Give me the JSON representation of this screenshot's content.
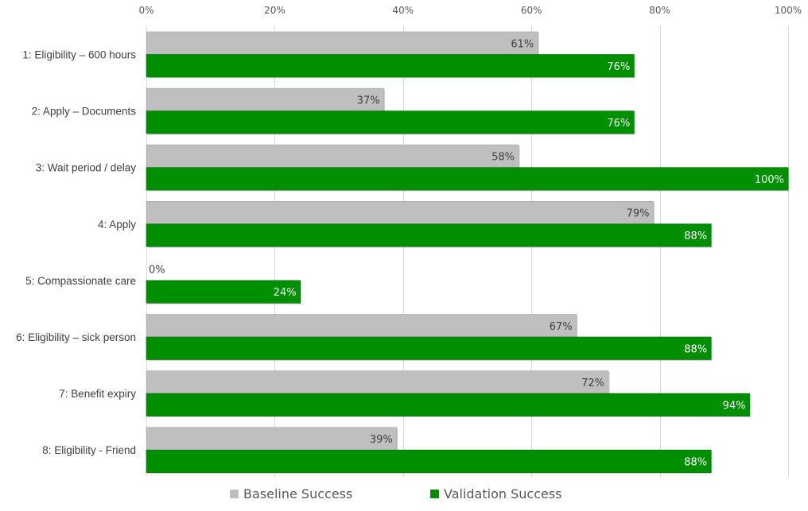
{
  "chart_data": {
    "type": "bar",
    "orientation": "horizontal",
    "title": "",
    "xlabel": "",
    "ylabel": "",
    "xlim": [
      0,
      100
    ],
    "x_ticks": [
      "0%",
      "20%",
      "40%",
      "60%",
      "80%",
      "100%"
    ],
    "x_tick_values": [
      0,
      20,
      40,
      60,
      80,
      100
    ],
    "grid": true,
    "x_axis_position": "top",
    "legend_position": "bottom",
    "categories": [
      "1: Eligibility – 600 hours",
      "2: Apply – Documents",
      "3: Wait period / delay",
      "4: Apply",
      "5: Compassionate care",
      "6: Eligibility – sick person",
      "7: Benefit expiry",
      "8: Eligibility - Friend"
    ],
    "series": [
      {
        "name": "Baseline Success",
        "color": "#BFBFBF",
        "values": [
          61,
          37,
          58,
          79,
          0,
          67,
          72,
          39
        ],
        "labels": [
          "61%",
          "37%",
          "58%",
          "79%",
          "0%",
          "67%",
          "72%",
          "39%"
        ]
      },
      {
        "name": "Validation Success",
        "color": "#008F00",
        "values": [
          76,
          76,
          100,
          88,
          24,
          88,
          94,
          88
        ],
        "labels": [
          "76%",
          "76%",
          "100%",
          "88%",
          "24%",
          "88%",
          "94%",
          "88%"
        ]
      }
    ]
  }
}
